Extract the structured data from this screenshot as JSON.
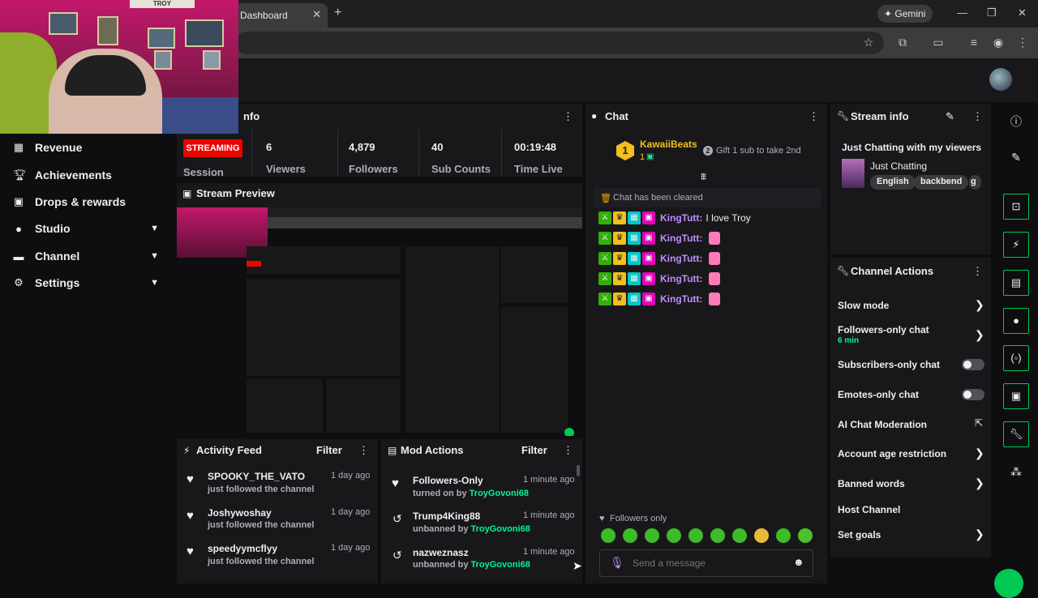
{
  "browser": {
    "tab_title": "Dashboard",
    "tab_close": "✕",
    "new_tab": "+",
    "gemini_label": "Gemini"
  },
  "nav": {
    "items": [
      {
        "label": "Revenue",
        "icon": "revenue-icon"
      },
      {
        "label": "Achievements",
        "icon": "trophy-icon"
      },
      {
        "label": "Drops & rewards",
        "icon": "gift-icon"
      },
      {
        "label": "Studio",
        "icon": "studio-icon"
      },
      {
        "label": "Channel",
        "icon": "channel-icon"
      },
      {
        "label": "Settings",
        "icon": "gear-icon"
      }
    ]
  },
  "stream_stats": {
    "title_suffix": "nfo",
    "status": "STREAMING",
    "session_label": "Session",
    "stats": [
      {
        "value": "6",
        "label": "Viewers"
      },
      {
        "value": "4,879",
        "label": "Followers"
      },
      {
        "value": "40",
        "label": "Sub Counts"
      },
      {
        "value": "00:19:48",
        "label": "Time Live"
      }
    ]
  },
  "stream_preview": {
    "title": "Stream Preview"
  },
  "activity_feed": {
    "title": "Activity Feed",
    "filter_label": "Filter",
    "items": [
      {
        "name": "SPOOKY_THE_VATO",
        "sub": "just followed the channel",
        "time": "1 day ago"
      },
      {
        "name": "Joshywoshay",
        "sub": "just followed the channel",
        "time": "1 day ago"
      },
      {
        "name": "speedyymcflyy",
        "sub": "just followed the channel",
        "time": "1 day ago"
      }
    ]
  },
  "mod_actions": {
    "title": "Mod Actions",
    "filter_label": "Filter",
    "items": [
      {
        "name": "Followers-Only",
        "action": "turned on by",
        "by": "TroyGovoni68",
        "time": "1 minute ago"
      },
      {
        "name": "Trump4King88",
        "action": "unbanned by",
        "by": "TroyGovoni68",
        "time": "1 minute ago"
      },
      {
        "name": "nazweznasz",
        "action": "unbanned by",
        "by": "TroyGovoni68",
        "time": "1 minute ago"
      }
    ]
  },
  "chat": {
    "title": "Chat",
    "top_gifter": {
      "rank": "1",
      "name": "KawaiiBeats",
      "count": "1"
    },
    "gift_hint_badge": "2",
    "gift_hint": "Gift 1 sub to take 2nd",
    "cleared": "Chat has been cleared",
    "messages": [
      {
        "user": "KingTutt:",
        "text": "I love Troy"
      },
      {
        "user": "KingTutt:",
        "text": ""
      },
      {
        "user": "KingTutt:",
        "text": ""
      },
      {
        "user": "KingTutt:",
        "text": ""
      },
      {
        "user": "KingTutt:",
        "text": ""
      }
    ],
    "mode": "Followers only",
    "input_placeholder": "Send a message"
  },
  "stream_info": {
    "title": "Stream info",
    "stream_title": "Just Chatting with my viewers",
    "category": "Just Chatting",
    "tags": [
      "English",
      "backbend",
      "g"
    ]
  },
  "channel_actions": {
    "title": "Channel Actions",
    "items": [
      {
        "label": "Slow mode"
      },
      {
        "label": "Followers-only chat",
        "sub": "6 min"
      },
      {
        "label": "Subscribers-only chat"
      },
      {
        "label": "Emotes-only chat"
      },
      {
        "label": "AI Chat Moderation"
      },
      {
        "label": "Account age restriction"
      },
      {
        "label": "Banned words"
      },
      {
        "label": "Host Channel"
      },
      {
        "label": "Set goals"
      }
    ]
  },
  "webcam": {
    "sign": "TROY"
  },
  "colors": {
    "accent": "#00f593",
    "streaming": "#eb0400",
    "username": "#c38bff",
    "rail_border": "#00c853"
  }
}
